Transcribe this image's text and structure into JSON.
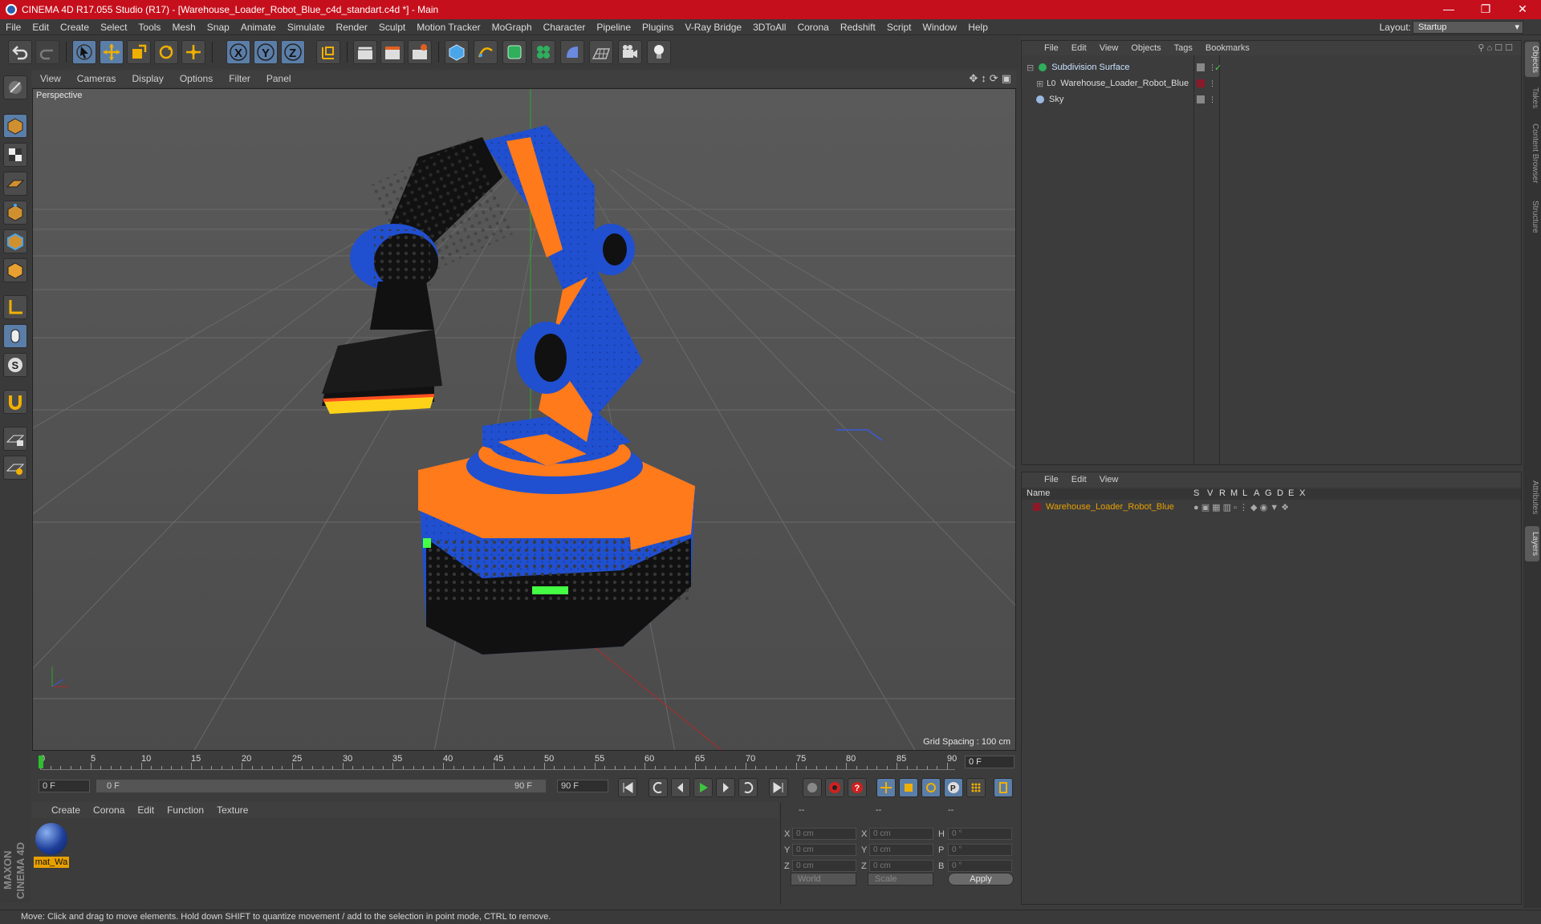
{
  "window": {
    "title": "CINEMA 4D R17.055 Studio (R17) - [Warehouse_Loader_Robot_Blue_c4d_standart.c4d *] - Main"
  },
  "menubar": {
    "items": [
      "File",
      "Edit",
      "Create",
      "Select",
      "Tools",
      "Mesh",
      "Snap",
      "Animate",
      "Simulate",
      "Render",
      "Sculpt",
      "Motion Tracker",
      "MoGraph",
      "Character",
      "Pipeline",
      "Plugins",
      "V-Ray Bridge",
      "3DToAll",
      "Corona",
      "Redshift",
      "Script",
      "Window",
      "Help"
    ],
    "layout_label": "Layout:",
    "layout_value": "Startup"
  },
  "viewport": {
    "menu": [
      "View",
      "Cameras",
      "Display",
      "Options",
      "Filter",
      "Panel"
    ],
    "camera_label": "Perspective",
    "grid_spacing": "Grid Spacing : 100 cm"
  },
  "timeline": {
    "ticks": [
      "0",
      "5",
      "10",
      "15",
      "20",
      "25",
      "30",
      "35",
      "40",
      "45",
      "50",
      "55",
      "60",
      "65",
      "70",
      "75",
      "80",
      "85",
      "90"
    ],
    "current_frame": "0 F",
    "start_field": "0 F",
    "range_start": "0 F",
    "range_end": "90 F",
    "end_field": "90 F"
  },
  "material_manager": {
    "menu": [
      "Create",
      "Corona",
      "Edit",
      "Function",
      "Texture"
    ],
    "materials": [
      {
        "name": "mat_Wa"
      }
    ]
  },
  "coordinates": {
    "headers": [
      "--",
      "--",
      "--"
    ],
    "rows": [
      {
        "a": "X",
        "av": "0 cm",
        "b": "X",
        "bv": "0 cm",
        "c": "H",
        "cv": "0 °"
      },
      {
        "a": "Y",
        "av": "0 cm",
        "b": "Y",
        "bv": "0 cm",
        "c": "P",
        "cv": "0 °"
      },
      {
        "a": "Z",
        "av": "0 cm",
        "b": "Z",
        "bv": "0 cm",
        "c": "B",
        "cv": "0 °"
      }
    ],
    "space": "World",
    "mode": "Scale",
    "apply": "Apply"
  },
  "object_manager": {
    "menu": [
      "File",
      "Edit",
      "View",
      "Objects",
      "Tags",
      "Bookmarks"
    ],
    "objects": [
      {
        "name": "Subdivision Surface",
        "color": "#c8e0ff"
      },
      {
        "name": "Warehouse_Loader_Robot_Blue",
        "color": "#d8d8d8"
      },
      {
        "name": "Sky",
        "color": "#d8d8d8"
      }
    ]
  },
  "layer_manager": {
    "menu": [
      "File",
      "Edit",
      "View"
    ],
    "columns": [
      "Name",
      "S",
      "V",
      "R",
      "M",
      "L",
      "A",
      "G",
      "D",
      "E",
      "X"
    ],
    "layers": [
      {
        "name": "Warehouse_Loader_Robot_Blue",
        "color": "#e8a000"
      }
    ]
  },
  "right_tabs": [
    "Objects",
    "Takes",
    "Content Browser",
    "Structure",
    "Attributes",
    "Layers"
  ],
  "status": "Move: Click and drag to move elements. Hold down SHIFT to quantize movement / add to the selection in point mode, CTRL to remove."
}
